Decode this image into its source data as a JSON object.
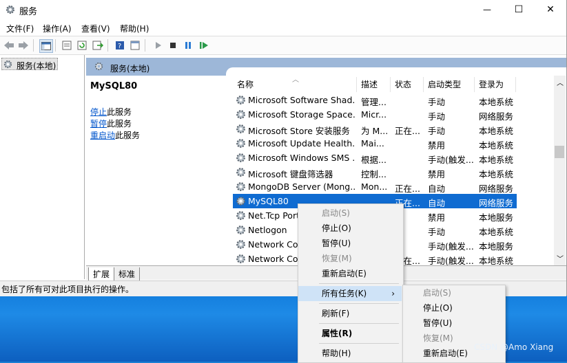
{
  "window": {
    "title": "服务",
    "min": "—",
    "max": "☐",
    "close": "✕"
  },
  "menu": [
    "文件(F)",
    "操作(A)",
    "查看(V)",
    "帮助(H)"
  ],
  "tree": {
    "root": "服务(本地)"
  },
  "pane_header": "服务(本地)",
  "detail": {
    "service_name": "MySQL80",
    "links": [
      {
        "link": "停止",
        "rest": "此服务"
      },
      {
        "link": "暂停",
        "rest": "此服务"
      },
      {
        "link": "重启动",
        "rest": "此服务"
      }
    ]
  },
  "columns": [
    "名称",
    "描述",
    "状态",
    "启动类型",
    "登录为"
  ],
  "rows": [
    {
      "name": "Microsoft Software Shad...",
      "desc": "管理...",
      "status": "",
      "startup": "手动",
      "logon": "本地系统",
      "selected": false
    },
    {
      "name": "Microsoft Storage Space...",
      "desc": "Micr...",
      "status": "",
      "startup": "手动",
      "logon": "网络服务",
      "selected": false
    },
    {
      "name": "Microsoft Store 安装服务",
      "desc": "为 M...",
      "status": "正在...",
      "startup": "手动",
      "logon": "本地系统",
      "selected": false
    },
    {
      "name": "Microsoft Update Health...",
      "desc": "Mai...",
      "status": "",
      "startup": "禁用",
      "logon": "本地系统",
      "selected": false
    },
    {
      "name": "Microsoft Windows SMS ...",
      "desc": "根据...",
      "status": "",
      "startup": "手动(触发...",
      "logon": "本地系统",
      "selected": false
    },
    {
      "name": "Microsoft 键盘筛选器",
      "desc": "控制...",
      "status": "",
      "startup": "禁用",
      "logon": "本地系统",
      "selected": false
    },
    {
      "name": "MongoDB Server (Mong...",
      "desc": "Mon...",
      "status": "正在...",
      "startup": "自动",
      "logon": "网络服务",
      "selected": false
    },
    {
      "name": "MySQL80",
      "desc": "",
      "status": "正在...",
      "startup": "自动",
      "logon": "网络服务",
      "selected": true
    },
    {
      "name": "Net.Tcp Port",
      "desc": "",
      "status": "",
      "startup": "禁用",
      "logon": "本地服务",
      "selected": false
    },
    {
      "name": "Netlogon",
      "desc": "",
      "status": "",
      "startup": "手动",
      "logon": "本地系统",
      "selected": false
    },
    {
      "name": "Network Co",
      "desc": "",
      "status": "",
      "startup": "手动(触发...",
      "logon": "本地服务",
      "selected": false
    },
    {
      "name": "Network Co",
      "desc": "",
      "status": "正在...",
      "startup": "手动(触发...",
      "logon": "本地系统",
      "selected": false
    }
  ],
  "tabs": [
    "扩展",
    "标准"
  ],
  "status_text": "包括了所有可对此项目执行的操作。",
  "context_menu": [
    {
      "label": "启动(S)",
      "disabled": true
    },
    {
      "label": "停止(O)",
      "disabled": false
    },
    {
      "label": "暂停(U)",
      "disabled": false
    },
    {
      "label": "恢复(M)",
      "disabled": true
    },
    {
      "label": "重新启动(E)",
      "disabled": false
    },
    {
      "label": "所有任务(K)",
      "disabled": false
    },
    {
      "label": "刷新(F)",
      "disabled": false
    },
    {
      "label": "属性(R)",
      "disabled": false
    },
    {
      "label": "帮助(H)",
      "disabled": false
    }
  ],
  "submenu": [
    {
      "label": "启动(S)",
      "disabled": true
    },
    {
      "label": "停止(O)",
      "disabled": false
    },
    {
      "label": "暂停(U)",
      "disabled": false
    },
    {
      "label": "恢复(M)",
      "disabled": true
    },
    {
      "label": "重新启动(E)",
      "disabled": false
    }
  ],
  "watermark": "CSDN @Amo Xiang",
  "colors": {
    "selection": "#0f6bd1",
    "submenu_highlight": "#cfe3f7",
    "pane_header": "#9db7d8"
  }
}
